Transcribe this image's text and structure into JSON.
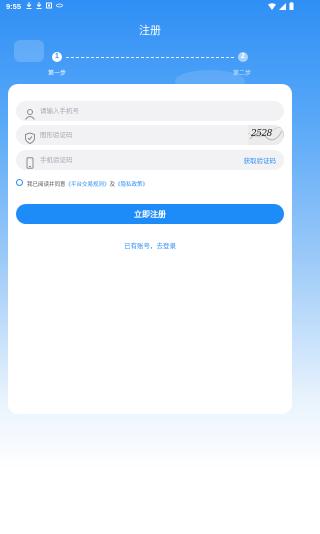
{
  "status_bar": {
    "time": "9:55",
    "icons": [
      "download-icon",
      "download-icon",
      "image-icon",
      "vpn-icon",
      "wifi-icon",
      "signal-icon",
      "battery-icon"
    ]
  },
  "header": {
    "title": "注册"
  },
  "steps": [
    {
      "number": "1",
      "label": "第一步",
      "active": true
    },
    {
      "number": "2",
      "label": "第二步",
      "active": false
    }
  ],
  "form": {
    "phone": {
      "placeholder": "请输入手机号",
      "icon": "user-icon"
    },
    "image_code": {
      "placeholder": "图形验证码",
      "icon": "shield-icon",
      "captcha_text": "2528"
    },
    "sms_code": {
      "placeholder": "手机验证码",
      "icon": "phone-icon",
      "get_code_label": "获取验证码"
    },
    "agreement": {
      "prefix": "我已阅读并同意",
      "link1": "《平台交易规则》",
      "and": "及",
      "link2": "《隐私政策》"
    },
    "submit_label": "立即注册",
    "login_link": "已有账号，去登录"
  },
  "colors": {
    "accent": "#1e8cf8",
    "primary_blue": "#2f8ff5"
  }
}
